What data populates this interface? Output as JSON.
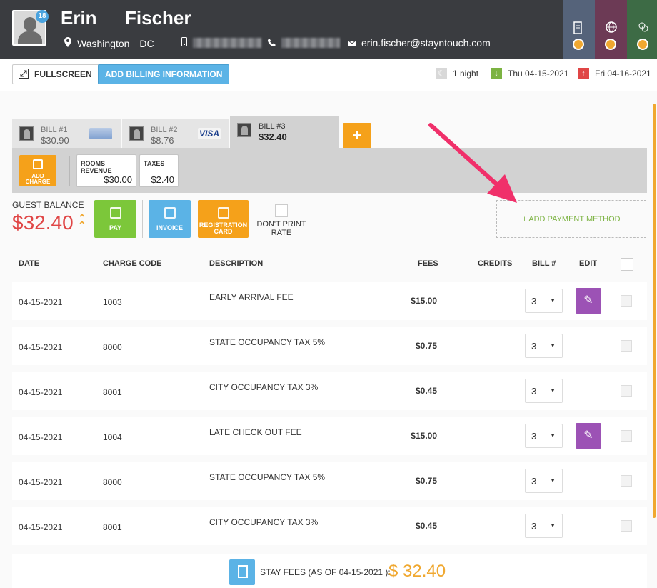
{
  "guest": {
    "first_name": "Erin",
    "last_name": "Fischer",
    "badge_count": "18",
    "city": "Washington",
    "state": "DC",
    "email": "erin.fischer@stayntouch.com"
  },
  "toolbar": {
    "fullscreen_label": "FULLSCREEN",
    "add_billing_label": "ADD BILLING INFORMATION",
    "nights": "1 night",
    "arrival": "Thu 04-15-2021",
    "departure": "Fri 04-16-2021"
  },
  "bills": [
    {
      "label": "BILL #1",
      "amount": "$30.90"
    },
    {
      "label": "BILL #2",
      "amount": "$8.76",
      "card": "VISA"
    },
    {
      "label": "BILL #3",
      "amount": "$32.40"
    }
  ],
  "add_bill_label": "+",
  "charges": {
    "add_charge_label": "ADD CHARGE",
    "rooms_revenue_label": "ROOMS REVENUE",
    "rooms_revenue_value": "$30.00",
    "taxes_label": "TAXES",
    "taxes_value": "$2.40"
  },
  "balance": {
    "label": "GUEST BALANCE",
    "value": "$32.40",
    "pay_label": "PAY",
    "invoice_label": "INVOICE",
    "reg_card_label": "REGISTRATION CARD",
    "dont_print_label": "DON'T PRINT RATE",
    "add_payment_label": "+ ADD PAYMENT METHOD"
  },
  "table": {
    "headers": [
      "DATE",
      "CHARGE CODE",
      "DESCRIPTION",
      "FEES",
      "CREDITS",
      "BILL #",
      "EDIT"
    ],
    "rows": [
      {
        "date": "04-15-2021",
        "code": "1003",
        "description": "EARLY ARRIVAL FEE",
        "fees": "$15.00",
        "bill": "3",
        "editable": true
      },
      {
        "date": "04-15-2021",
        "code": "8000",
        "description": "STATE OCCUPANCY TAX 5%",
        "fees": "$0.75",
        "bill": "3",
        "editable": false
      },
      {
        "date": "04-15-2021",
        "code": "8001",
        "description": "CITY OCCUPANCY TAX 3%",
        "fees": "$0.45",
        "bill": "3",
        "editable": false
      },
      {
        "date": "04-15-2021",
        "code": "1004",
        "description": "LATE CHECK OUT FEE",
        "fees": "$15.00",
        "bill": "3",
        "editable": true
      },
      {
        "date": "04-15-2021",
        "code": "8000",
        "description": "STATE OCCUPANCY TAX 5%",
        "fees": "$0.75",
        "bill": "3",
        "editable": false
      },
      {
        "date": "04-15-2021",
        "code": "8001",
        "description": "CITY OCCUPANCY TAX 3%",
        "fees": "$0.45",
        "bill": "3",
        "editable": false
      }
    ]
  },
  "footer": {
    "stay_fees_label": "STAY FEES (AS OF 04-15-2021 ):",
    "stay_fees_value": "$ 32.40"
  },
  "colors": {
    "header_bg": "#3a3c40",
    "accent_orange": "#f5a11a",
    "accent_blue": "#5bb3e6",
    "pay_green": "#7cc73a",
    "edit_purple": "#9c52b5",
    "balance_red": "#e04646",
    "annotation_arrow": "#f0306a"
  }
}
